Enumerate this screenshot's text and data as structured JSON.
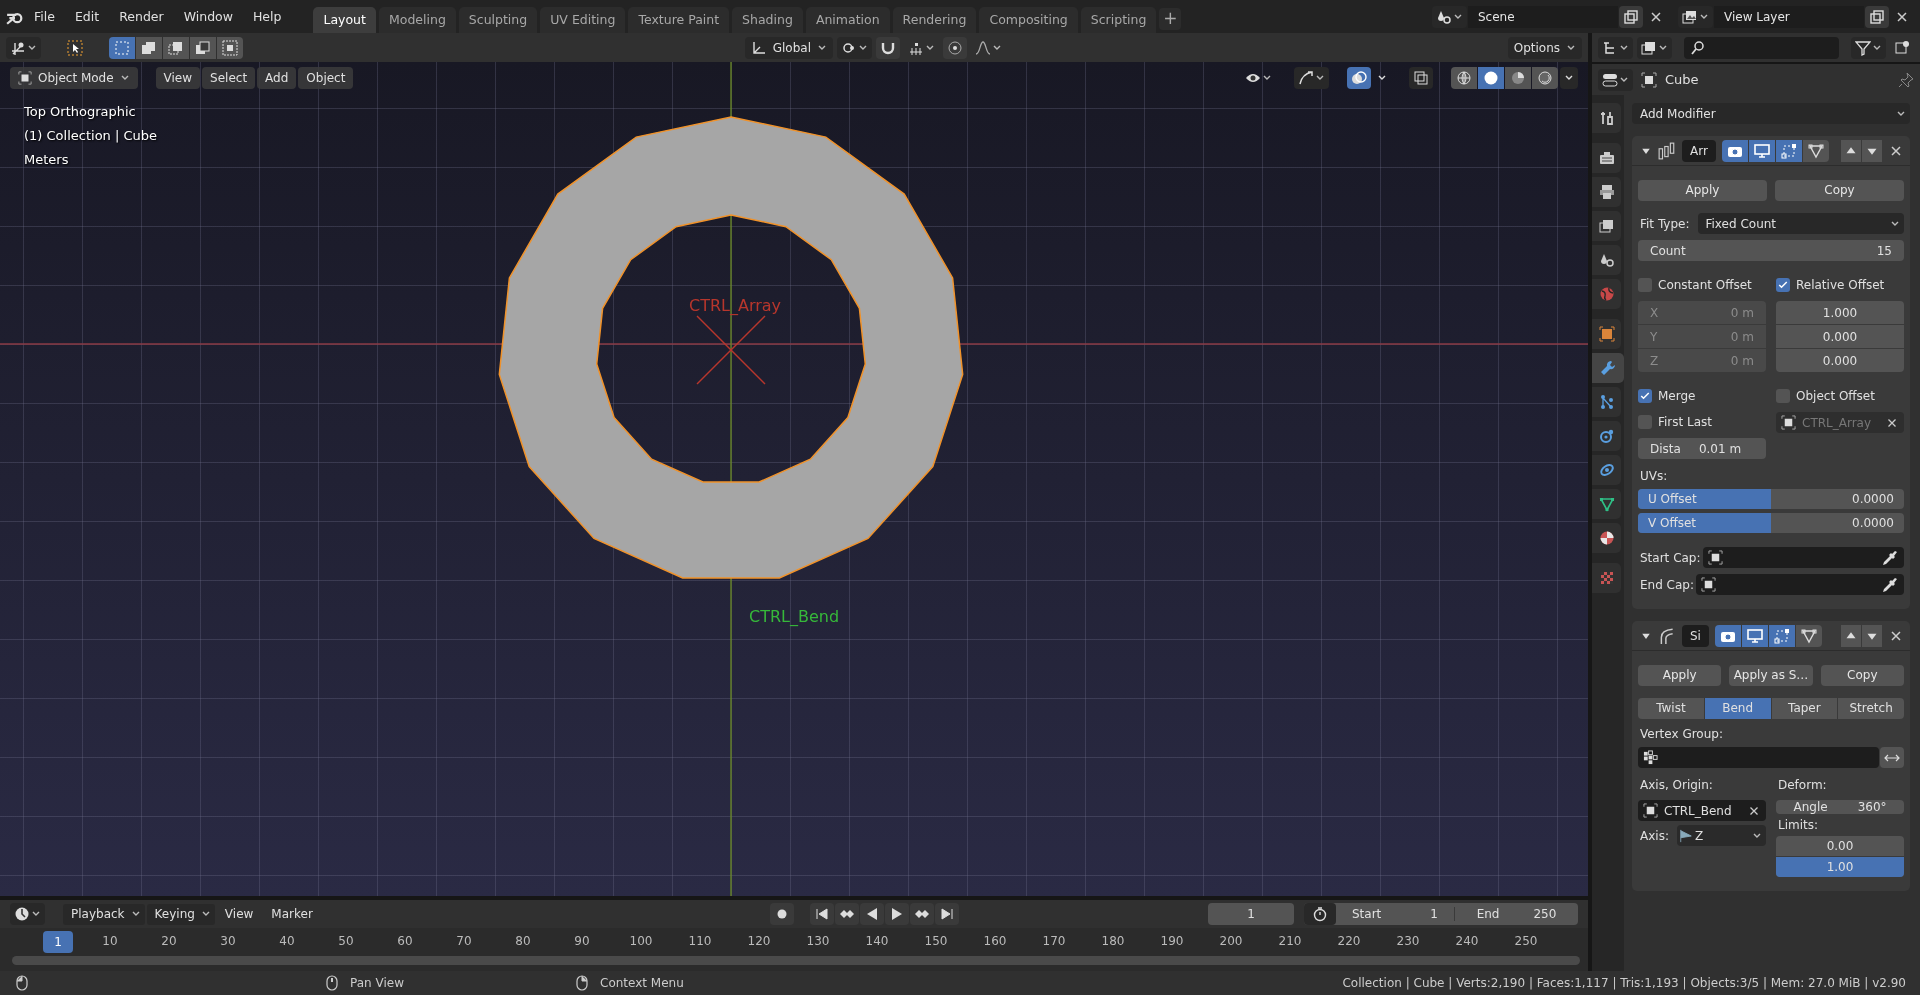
{
  "menu": [
    "File",
    "Edit",
    "Render",
    "Window",
    "Help"
  ],
  "workspaces": [
    {
      "label": "Layout",
      "selected": true
    },
    {
      "label": "Modeling",
      "selected": false
    },
    {
      "label": "Sculpting",
      "selected": false
    },
    {
      "label": "UV Editing",
      "selected": false
    },
    {
      "label": "Texture Paint",
      "selected": false
    },
    {
      "label": "Shading",
      "selected": false
    },
    {
      "label": "Animation",
      "selected": false
    },
    {
      "label": "Rendering",
      "selected": false
    },
    {
      "label": "Compositing",
      "selected": false
    },
    {
      "label": "Scripting",
      "selected": false
    }
  ],
  "add_workspace": "+",
  "scene": "Scene",
  "view_layer": "View Layer",
  "tool_header": {
    "select_modes": [
      {
        "selected": true
      },
      {
        "selected": false
      },
      {
        "selected": false
      },
      {
        "selected": false
      },
      {
        "selected": false
      }
    ],
    "orientation": "Global",
    "options": "Options"
  },
  "viewport": {
    "mode": "Object Mode",
    "menus": [
      "View",
      "Select",
      "Add",
      "Object"
    ],
    "info": [
      "Top Orthographic",
      "(1) Collection | Cube",
      "Meters"
    ],
    "overlays_on": true,
    "shading": [
      {
        "selected": false
      },
      {
        "selected": true
      },
      {
        "selected": false
      },
      {
        "selected": false
      }
    ],
    "empties": [
      {
        "kind": "cross",
        "label": "CTRL_Array",
        "color": "#b8362c"
      },
      {
        "kind": "point",
        "label": "CTRL_Bend",
        "color": "#36b83a"
      }
    ]
  },
  "properties": {
    "object": "Cube",
    "tab_groups": [
      [
        {
          "kind": "tool",
          "selected": false
        }
      ],
      [
        {
          "kind": "render",
          "selected": false
        },
        {
          "kind": "output",
          "selected": false
        },
        {
          "kind": "view_layer",
          "selected": false
        },
        {
          "kind": "scene",
          "selected": false
        },
        {
          "kind": "world",
          "selected": false
        }
      ],
      [
        {
          "kind": "object",
          "selected": false
        },
        {
          "kind": "modifiers",
          "selected": true
        },
        {
          "kind": "particles",
          "selected": false
        },
        {
          "kind": "physics",
          "selected": false
        },
        {
          "kind": "constraints",
          "selected": false
        },
        {
          "kind": "data",
          "selected": false
        },
        {
          "kind": "material",
          "selected": false
        }
      ],
      [
        {
          "kind": "texture",
          "selected": false
        }
      ]
    ],
    "add_modifier": "Add Modifier",
    "modifiers": [
      {
        "kind": "array",
        "name": "Arr",
        "expanded": true,
        "toggles": [
          {
            "kind": "render",
            "on": true
          },
          {
            "kind": "viewport",
            "on": true
          },
          {
            "kind": "editmode",
            "on": true
          },
          {
            "kind": "cage",
            "on": false
          }
        ],
        "buttons": [
          "Apply",
          "Copy"
        ],
        "fit_type": {
          "label": "Fit Type:",
          "value": "Fixed Count"
        },
        "count": {
          "label": "Count",
          "value": "15"
        },
        "constant_offset": {
          "label": "Constant Offset",
          "checked": false,
          "fields": [
            {
              "axis": "X",
              "value": "0 m"
            },
            {
              "axis": "Y",
              "value": "0 m"
            },
            {
              "axis": "Z",
              "value": "0 m"
            }
          ]
        },
        "relative_offset": {
          "label": "Relative Offset",
          "checked": true,
          "fields": [
            "1.000",
            "0.000",
            "0.000"
          ]
        },
        "merge": {
          "label": "Merge",
          "checked": true
        },
        "object_offset": {
          "label": "Object Offset",
          "checked": false,
          "object": "CTRL_Array"
        },
        "first_last": {
          "label": "First Last",
          "checked": false
        },
        "distance": {
          "label": "Dista",
          "value": "0.01 m"
        },
        "uvs_label": "UVs:",
        "uv_offsets": [
          {
            "label": "U Offset",
            "value": "0.0000",
            "level": 0.5
          },
          {
            "label": "V Offset",
            "value": "0.0000",
            "level": 0.5
          }
        ],
        "caps": [
          {
            "label": "Start Cap:"
          },
          {
            "label": "End Cap:"
          }
        ]
      },
      {
        "kind": "simple_deform",
        "name": "Si",
        "expanded": true,
        "toggles": [
          {
            "kind": "render",
            "on": true
          },
          {
            "kind": "viewport",
            "on": true
          },
          {
            "kind": "editmode",
            "on": true
          },
          {
            "kind": "cage",
            "on": false
          }
        ],
        "buttons": [
          "Apply",
          "Apply as S…",
          "Copy"
        ],
        "modes": [
          {
            "label": "Twist",
            "selected": false
          },
          {
            "label": "Bend",
            "selected": true
          },
          {
            "label": "Taper",
            "selected": false
          },
          {
            "label": "Stretch",
            "selected": false
          }
        ],
        "vertex_group_label": "Vertex Group:",
        "axis_origin": {
          "label": "Axis, Origin:",
          "object": "CTRL_Bend"
        },
        "axis": {
          "label": "Axis:",
          "value": "Z"
        },
        "deform": {
          "label": "Deform:",
          "angle_label": "Angle",
          "angle": "360°"
        },
        "limits": {
          "label": "Limits:",
          "values": [
            {
              "value": "0.00",
              "level": 0
            },
            {
              "value": "1.00",
              "level": 1
            }
          ]
        }
      }
    ]
  },
  "timeline": {
    "menus": [
      {
        "label": "Playback",
        "kind": "dropdown"
      },
      {
        "label": "Keying",
        "kind": "dropdown"
      },
      {
        "label": "View",
        "kind": "plain"
      },
      {
        "label": "Marker",
        "kind": "plain"
      }
    ],
    "current_frame": "1",
    "start": {
      "label": "Start",
      "value": "1"
    },
    "end": {
      "label": "End",
      "value": "250"
    },
    "frame_marker": "1",
    "ruler": [
      "10",
      "20",
      "30",
      "40",
      "50",
      "60",
      "70",
      "80",
      "90",
      "100",
      "110",
      "120",
      "130",
      "140",
      "150",
      "160",
      "170",
      "180",
      "190",
      "200",
      "210",
      "220",
      "230",
      "240",
      "250"
    ]
  },
  "status_bar": {
    "hints": [
      {
        "kind": "left"
      },
      {
        "kind": "middle",
        "label": "Pan View"
      },
      {
        "kind": "right",
        "label": "Context Menu"
      }
    ],
    "stats": "Collection | Cube | Verts:2,190 | Faces:1,117 | Tris:1,193 | Objects:3/5 | Mem: 27.0 MiB | v2.90"
  }
}
